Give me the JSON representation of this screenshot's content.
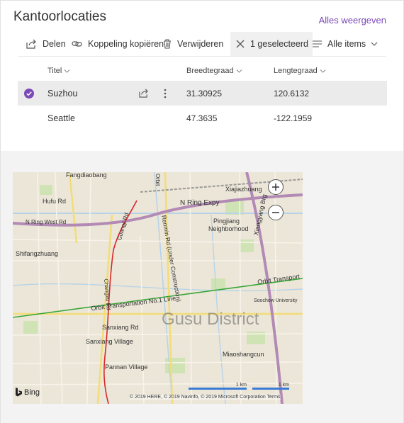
{
  "header": {
    "title": "Kantoorlocaties",
    "show_all": "Alles weergeven"
  },
  "commands": {
    "share": "Delen",
    "copy_link": "Koppeling kopiëren",
    "delete": "Verwijderen",
    "selected": "1 geselecteerd",
    "view": "Alle items"
  },
  "columns": {
    "title": "Titel",
    "latitude": "Breedtegraad",
    "longitude": "Lengtegraad"
  },
  "rows": [
    {
      "title": "Suzhou",
      "latitude": "31.30925",
      "longitude": "120.6132",
      "selected": true
    },
    {
      "title": "Seattle",
      "latitude": "47.3635",
      "longitude": "-122.1959",
      "selected": false
    }
  ],
  "map": {
    "labels": {
      "fangdiaobang": "Fangdiaobang",
      "hufu_rd": "Hufu Rd",
      "n_ring_west": "N Ring West Rd",
      "n_ring_expy": "N Ring Expy",
      "xiajiazhuang": "Xiajiazhuang",
      "shifangzhuang": "Shifangzhuang",
      "pingjiang": "Pingjiang",
      "neighborhood": "Neighborhood",
      "xiangyang": "Xiangyang Brg",
      "orbit_line": "Orbit Transportation No.1 Line",
      "orbit_right": "Orbit Transport",
      "gusu": "Gusu District",
      "sanxiang": "Sanxiang Rd",
      "sanxiang_village": "Sanxiang Village",
      "pannan": "Pannan Village",
      "miaoshangcun": "Miaoshangcun",
      "soochow": "Soochow University",
      "renmin": "Renmin Rd (Under Construction)",
      "guangji": "Guangji Rd",
      "changxu": "Changxu Rd",
      "orbit_top": "Orbit"
    },
    "scale_left": "1 km",
    "scale_right": "1 km",
    "brand": "Bing",
    "copyright": "© 2019 HERE, © 2019 Navinfo, © 2019 Microsoft Corporation Terms"
  }
}
